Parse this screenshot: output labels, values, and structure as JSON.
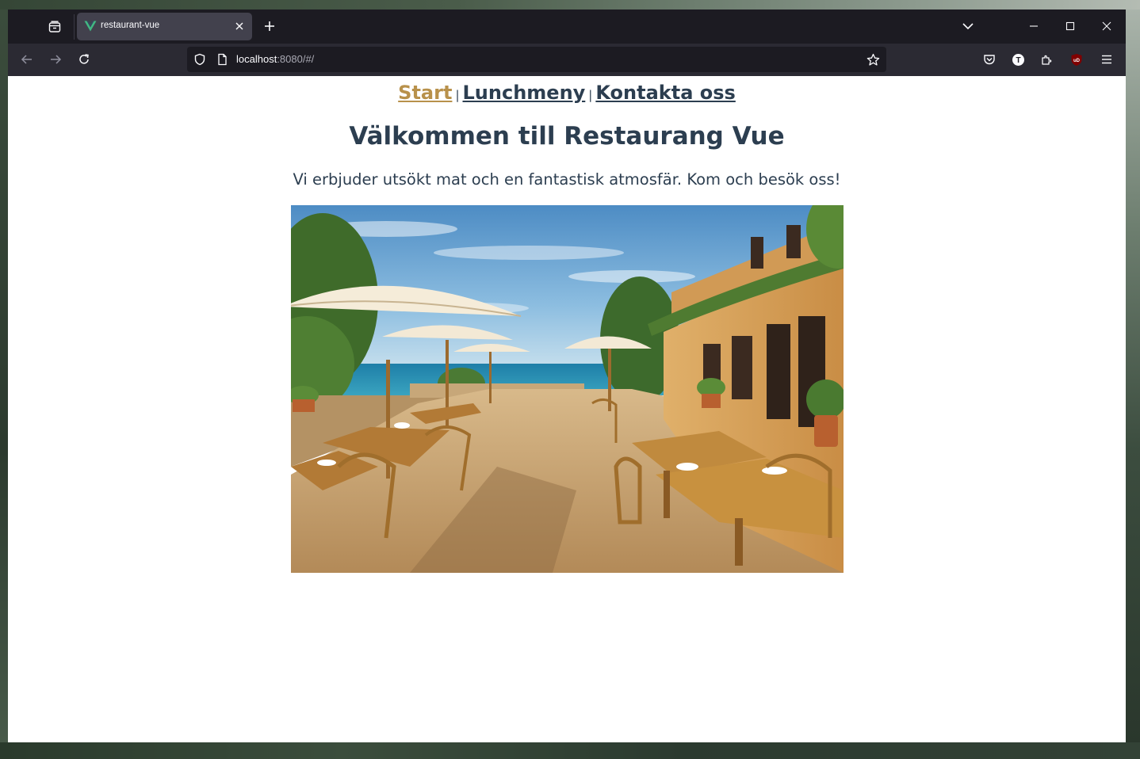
{
  "browser": {
    "tab": {
      "title": "restaurant-vue"
    },
    "urlbar": {
      "host": "localhost",
      "rest": ":8080/#/"
    },
    "toolbar_icons": [
      "pocket-icon",
      "translate-icon",
      "extensions-icon",
      "ublock-icon",
      "menu-icon"
    ],
    "ublock_badge": "uD",
    "translate_badge": "T"
  },
  "site": {
    "nav": {
      "start": "Start",
      "lunch": "Lunchmeny",
      "contact": "Kontakta oss",
      "separator": "|"
    },
    "title": "Välkommen till Restaurang Vue",
    "lead": "Vi erbjuder utsökt mat och en fantastisk atmosfär. Kom och besök oss!",
    "colors": {
      "text": "#2c3e50",
      "active_link": "#b8914b"
    }
  }
}
